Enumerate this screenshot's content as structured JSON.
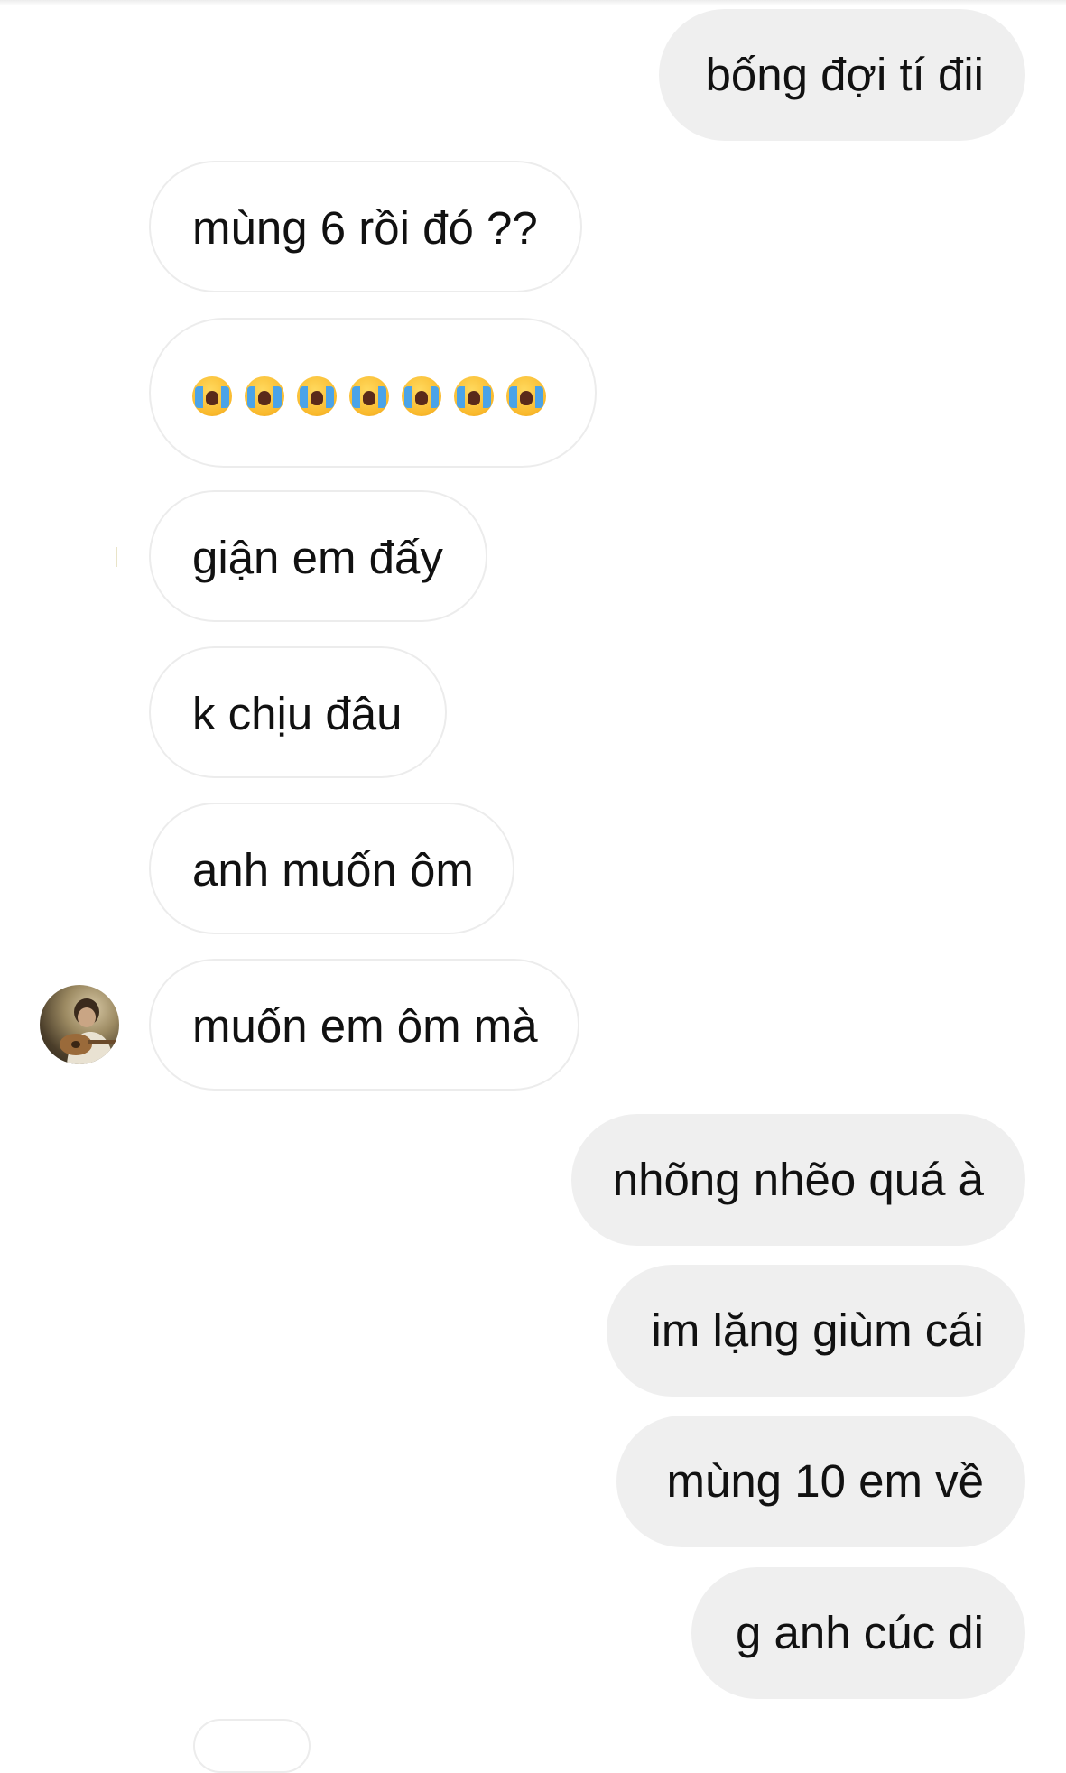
{
  "messages": [
    {
      "direction": "sent",
      "text": "bống đợi tí đii"
    },
    {
      "direction": "received",
      "text": "mùng 6 rồi đó ??"
    },
    {
      "direction": "received",
      "type": "emoji",
      "emoji_icon": "loudly-crying-face-icon",
      "emoji_count": 7
    },
    {
      "direction": "received",
      "text": "giận em đấy"
    },
    {
      "direction": "received",
      "text": "k chịu đâu"
    },
    {
      "direction": "received",
      "text": "anh muốn ôm"
    },
    {
      "direction": "received",
      "text": "muốn em ôm mà"
    },
    {
      "direction": "sent",
      "text": "nhõng nhẽo quá à"
    },
    {
      "direction": "sent",
      "text": "im lặng giùm cái"
    },
    {
      "direction": "sent",
      "text": "mùng 10 em về"
    },
    {
      "direction": "sent",
      "text": "g anh cúc di"
    }
  ],
  "colors": {
    "sent_bubble": "#efefef",
    "received_bubble_border": "#ececec",
    "background": "#ffffff",
    "text": "#111111"
  },
  "contact": {
    "avatar_icon": "profile-photo-guitar"
  }
}
